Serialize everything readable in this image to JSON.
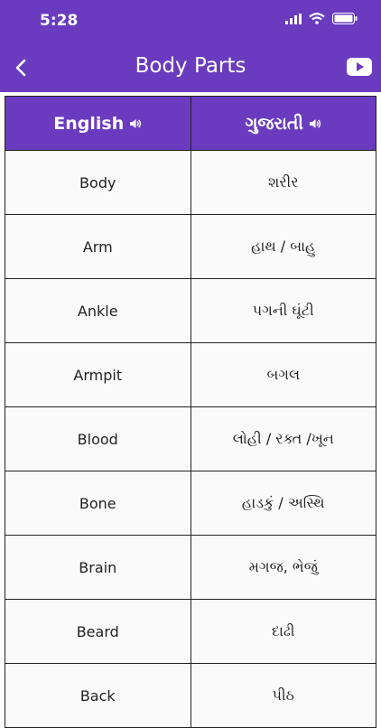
{
  "status_bar": {
    "time": "5:28"
  },
  "nav": {
    "title": "Body Parts"
  },
  "table": {
    "headers": [
      "English",
      "ગુજરાતી"
    ],
    "rows": [
      [
        "Body",
        "શરીર"
      ],
      [
        "Arm",
        "હાથ / બાહુ"
      ],
      [
        "Ankle",
        "પગની ઘૂંટી"
      ],
      [
        "Armpit",
        "બગલ"
      ],
      [
        "Blood",
        "લોહી / રક્ત /ખૂન"
      ],
      [
        "Bone",
        "હાડકું / અસ્થિ"
      ],
      [
        "Brain",
        "મગજ, ભેજું"
      ],
      [
        "Beard",
        "દાઢી"
      ],
      [
        "Back",
        "પીઠ"
      ]
    ]
  },
  "colors": {
    "accent": "#6a3bbf"
  }
}
